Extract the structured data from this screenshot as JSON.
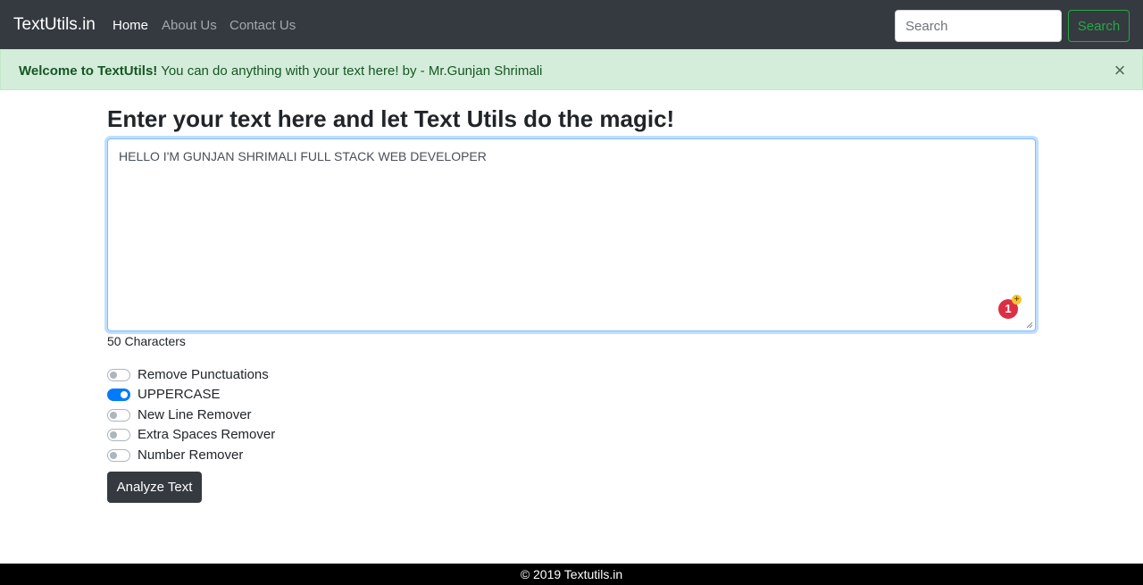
{
  "navbar": {
    "brand": "TextUtils.in",
    "links": [
      {
        "label": "Home",
        "active": true
      },
      {
        "label": "About Us",
        "active": false
      },
      {
        "label": "Contact Us",
        "active": false
      }
    ],
    "search": {
      "placeholder": "Search",
      "button_label": "Search"
    }
  },
  "alert": {
    "strong": "Welcome to TextUtils!",
    "message": " You can do anything with your text here! by - Mr.Gunjan Shrimali",
    "close": "×"
  },
  "main": {
    "heading": "Enter your text here and let Text Utils do the magic!",
    "textarea_value": "HELLO I'M GUNJAN SHRIMALI FULL STACK WEB DEVELOPER",
    "badge_count": "1",
    "char_count": "50 Characters",
    "options": [
      {
        "label": "Remove Punctuations",
        "checked": false
      },
      {
        "label": "UPPERCASE",
        "checked": true
      },
      {
        "label": "New Line Remover",
        "checked": false
      },
      {
        "label": "Extra Spaces Remover",
        "checked": false
      },
      {
        "label": "Number Remover",
        "checked": false
      }
    ],
    "analyze_label": "Analyze Text"
  },
  "footer": {
    "text": "© 2019 Textutils.in"
  },
  "colors": {
    "navbar": "#343a40",
    "alert_bg": "#d4edda",
    "alert_text": "#155724",
    "accent": "#007bff",
    "success": "#28a745"
  }
}
